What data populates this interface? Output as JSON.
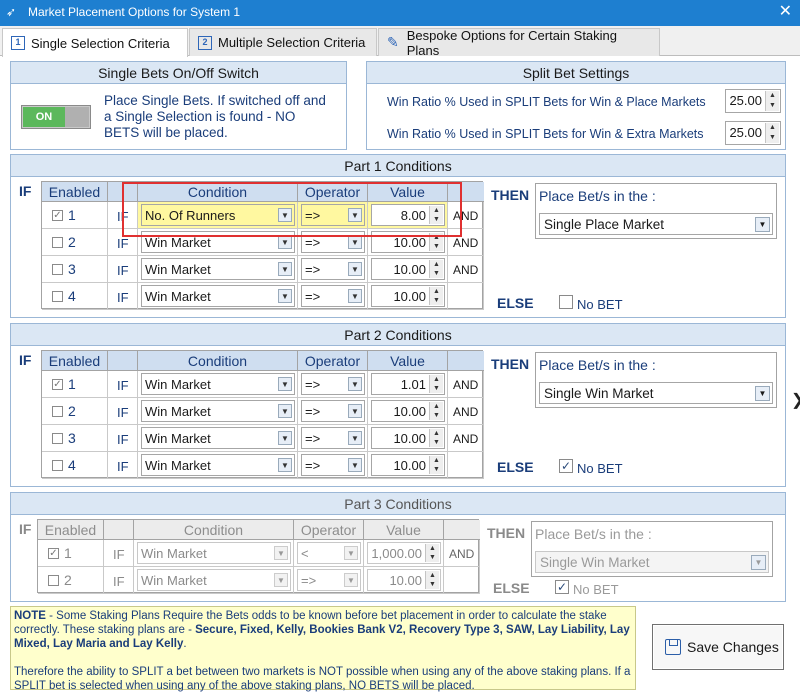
{
  "window": {
    "title": "Market Placement Options for System 1",
    "close_glyph": "✕"
  },
  "tabs": [
    {
      "label": "Single Selection Criteria",
      "icon": "1"
    },
    {
      "label": "Multiple Selection Criteria",
      "icon": "2"
    },
    {
      "label": "Bespoke Options for Certain Staking Plans",
      "icon": "pencil"
    }
  ],
  "single_bets": {
    "heading": "Single Bets On/Off Switch",
    "toggle_label": "ON",
    "description": "Place Single Bets. If switched off and a Single Selection is found - NO BETS will be placed."
  },
  "split_bets": {
    "heading": "Split Bet Settings",
    "rows": [
      {
        "label": "Win Ratio % Used in SPLIT Bets for Win & Place Markets",
        "value": "25.00"
      },
      {
        "label": "Win Ratio % Used in SPLIT Bets for Win & Extra Markets",
        "value": "25.00"
      }
    ]
  },
  "labels": {
    "if": "IF",
    "then": "THEN",
    "else": "ELSE",
    "place_bets": "Place Bet/s in the :",
    "no_bet": "No BET",
    "and": "AND"
  },
  "grid_headers": {
    "enabled": "Enabled",
    "condition": "Condition",
    "operator": "Operator",
    "value": "Value"
  },
  "part1": {
    "heading": "Part 1 Conditions",
    "rows": [
      {
        "num": "1",
        "enabled": true,
        "condition": "No. Of Runners",
        "operator": "=>",
        "value": "8.00",
        "and": "AND"
      },
      {
        "num": "2",
        "enabled": false,
        "condition": "Win Market",
        "operator": "=>",
        "value": "10.00",
        "and": "AND"
      },
      {
        "num": "3",
        "enabled": false,
        "condition": "Win Market",
        "operator": "=>",
        "value": "10.00",
        "and": "AND"
      },
      {
        "num": "4",
        "enabled": false,
        "condition": "Win Market",
        "operator": "=>",
        "value": "10.00",
        "and": ""
      }
    ],
    "market": "Single Place Market",
    "no_bet_checked": false
  },
  "part2": {
    "heading": "Part 2 Conditions",
    "rows": [
      {
        "num": "1",
        "enabled": true,
        "condition": "Win Market",
        "operator": "=>",
        "value": "1.01",
        "and": "AND"
      },
      {
        "num": "2",
        "enabled": false,
        "condition": "Win Market",
        "operator": "=>",
        "value": "10.00",
        "and": "AND"
      },
      {
        "num": "3",
        "enabled": false,
        "condition": "Win Market",
        "operator": "=>",
        "value": "10.00",
        "and": "AND"
      },
      {
        "num": "4",
        "enabled": false,
        "condition": "Win Market",
        "operator": "=>",
        "value": "10.00",
        "and": ""
      }
    ],
    "market": "Single Win Market",
    "no_bet_checked": true
  },
  "part3": {
    "heading": "Part 3 Conditions",
    "rows": [
      {
        "num": "1",
        "enabled": true,
        "condition": "Win Market",
        "operator": "<",
        "value": "1,000.00",
        "and": "AND"
      },
      {
        "num": "2",
        "enabled": false,
        "condition": "Win Market",
        "operator": "=>",
        "value": "10.00",
        "and": ""
      }
    ],
    "market": "Single Win Market",
    "no_bet_checked": true
  },
  "note": {
    "lead": "NOTE",
    "p1_pre": " - Some Staking Plans Require the Bets odds to be known before bet placement in order to calculate the stake correctly. These staking plans are - ",
    "p1_plans": "Secure, Fixed, Kelly, Bookies Bank V2, Recovery Type 3, SAW, Lay Liability, Lay Mixed, Lay Maria and Lay Kelly",
    "p1_end": ".",
    "p2": "Therefore the ability to SPLIT a bet between two markets is NOT possible when using any of the above staking plans. If a SPLIT bet is selected when using any of the above staking plans, NO BETS will be placed."
  },
  "save_button": {
    "label": "Save Changes"
  },
  "colors": {
    "titlebar": "#1e7fd0",
    "header_fill": "#dbe7f4",
    "highlight": "#fff8a0",
    "red_box": "#e03030",
    "note_bg": "#ffffcc"
  }
}
